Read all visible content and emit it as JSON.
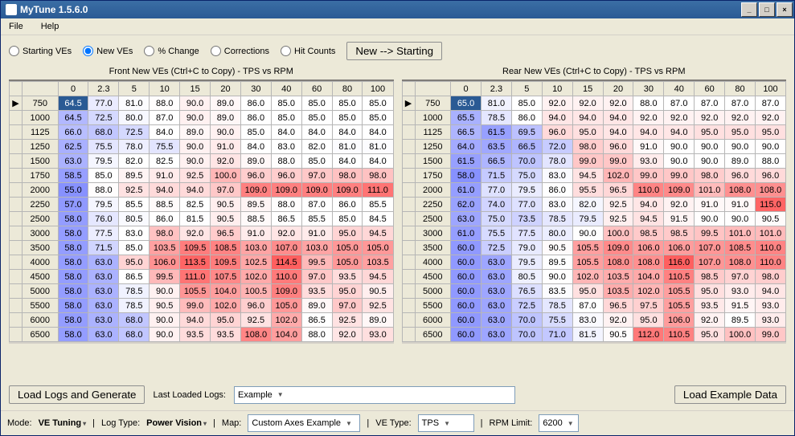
{
  "window": {
    "title": "MyTune 1.5.6.0",
    "min": "_",
    "max": "□",
    "close": "×"
  },
  "menu": {
    "file": "File",
    "help": "Help"
  },
  "radios": {
    "starting": "Starting VEs",
    "new": "New VEs",
    "pct": "% Change",
    "corr": "Corrections",
    "hits": "Hit Counts",
    "selected": "new"
  },
  "newStartBtn": "New --> Starting",
  "frontTitle": "Front New VEs (Ctrl+C to Copy) - TPS vs RPM",
  "rearTitle": "Rear New VEs (Ctrl+C to Copy) - TPS vs RPM",
  "cols": [
    "0",
    "2.3",
    "5",
    "10",
    "15",
    "20",
    "30",
    "40",
    "60",
    "80",
    "100"
  ],
  "rows": [
    "750",
    "1000",
    "1125",
    "1250",
    "1500",
    "1750",
    "2000",
    "2250",
    "2500",
    "3000",
    "3500",
    "4000",
    "4500",
    "5000",
    "5500",
    "6000",
    "6500"
  ],
  "chart_data": [
    {
      "type": "table",
      "title": "Front New VEs - TPS vs RPM",
      "xlabel": "TPS",
      "ylabel": "RPM",
      "x": [
        "0",
        "2.3",
        "5",
        "10",
        "15",
        "20",
        "30",
        "40",
        "60",
        "80",
        "100"
      ],
      "y": [
        "750",
        "1000",
        "1125",
        "1250",
        "1500",
        "1750",
        "2000",
        "2250",
        "2500",
        "3000",
        "3500",
        "4000",
        "4500",
        "5000",
        "5500",
        "6000",
        "6500"
      ],
      "values": [
        [
          64.5,
          77.0,
          81.0,
          88.0,
          90.0,
          89.0,
          86.0,
          85.0,
          85.0,
          85.0,
          85.0
        ],
        [
          64.5,
          72.5,
          80.0,
          87.0,
          90.0,
          89.0,
          86.0,
          85.0,
          85.0,
          85.0,
          85.0
        ],
        [
          66.0,
          68.0,
          72.5,
          84.0,
          89.0,
          90.0,
          85.0,
          84.0,
          84.0,
          84.0,
          84.0
        ],
        [
          62.5,
          75.5,
          78.0,
          75.5,
          90.0,
          91.0,
          84.0,
          83.0,
          82.0,
          81.0,
          81.0
        ],
        [
          63.0,
          79.5,
          82.0,
          82.5,
          90.0,
          92.0,
          89.0,
          88.0,
          85.0,
          84.0,
          84.0
        ],
        [
          58.5,
          85.0,
          89.5,
          91.0,
          92.5,
          100.0,
          96.0,
          96.0,
          97.0,
          98.0,
          98.0
        ],
        [
          55.0,
          88.0,
          92.5,
          94.0,
          94.0,
          97.0,
          109.0,
          109.0,
          109.0,
          109.0,
          111.0
        ],
        [
          57.0,
          79.5,
          85.5,
          88.5,
          82.5,
          90.5,
          89.5,
          88.0,
          87.0,
          86.0,
          85.5
        ],
        [
          58.0,
          76.0,
          80.5,
          86.0,
          81.5,
          90.5,
          88.5,
          86.5,
          85.5,
          85.0,
          84.5
        ],
        [
          58.0,
          77.5,
          83.0,
          98.0,
          92.0,
          96.5,
          91.0,
          92.0,
          91.0,
          95.0,
          94.5
        ],
        [
          58.0,
          71.5,
          85.0,
          103.5,
          109.5,
          108.5,
          103.0,
          107.0,
          103.0,
          105.0,
          105.0
        ],
        [
          58.0,
          63.0,
          95.0,
          106.0,
          113.5,
          109.5,
          102.5,
          114.5,
          99.5,
          105.0,
          103.5
        ],
        [
          58.0,
          63.0,
          86.5,
          99.5,
          111.0,
          107.5,
          102.0,
          110.0,
          97.0,
          93.5,
          94.5
        ],
        [
          58.0,
          63.0,
          78.5,
          90.0,
          105.5,
          104.0,
          100.5,
          109.0,
          93.5,
          95.0,
          90.5
        ],
        [
          58.0,
          63.0,
          78.5,
          90.5,
          99.0,
          102.0,
          96.0,
          105.0,
          89.0,
          97.0,
          92.5
        ],
        [
          58.0,
          63.0,
          68.0,
          90.0,
          94.0,
          95.0,
          92.5,
          102.0,
          86.5,
          92.5,
          89.0
        ],
        [
          58.0,
          63.0,
          68.0,
          90.0,
          93.5,
          93.5,
          108.0,
          104.0,
          88.0,
          92.0,
          93.0
        ]
      ]
    },
    {
      "type": "table",
      "title": "Rear New VEs - TPS vs RPM",
      "xlabel": "TPS",
      "ylabel": "RPM",
      "x": [
        "0",
        "2.3",
        "5",
        "10",
        "15",
        "20",
        "30",
        "40",
        "60",
        "80",
        "100"
      ],
      "y": [
        "750",
        "1000",
        "1125",
        "1250",
        "1500",
        "1750",
        "2000",
        "2250",
        "2500",
        "3000",
        "3500",
        "4000",
        "4500",
        "5000",
        "5500",
        "6000",
        "6500"
      ],
      "values": [
        [
          65.0,
          81.0,
          85.0,
          92.0,
          92.0,
          92.0,
          88.0,
          87.0,
          87.0,
          87.0,
          87.0
        ],
        [
          65.5,
          78.5,
          86.0,
          94.0,
          94.0,
          94.0,
          92.0,
          92.0,
          92.0,
          92.0,
          92.0
        ],
        [
          66.5,
          61.5,
          69.5,
          96.0,
          95.0,
          94.0,
          94.0,
          94.0,
          95.0,
          95.0,
          95.0
        ],
        [
          64.0,
          63.5,
          66.5,
          72.0,
          98.0,
          96.0,
          91.0,
          90.0,
          90.0,
          90.0,
          90.0
        ],
        [
          61.5,
          66.5,
          70.0,
          78.0,
          99.0,
          99.0,
          93.0,
          90.0,
          90.0,
          89.0,
          88.0
        ],
        [
          58.0,
          71.5,
          75.0,
          83.0,
          94.5,
          102.0,
          99.0,
          99.0,
          98.0,
          96.0,
          96.0
        ],
        [
          61.0,
          77.0,
          79.5,
          86.0,
          95.5,
          96.5,
          110.0,
          109.0,
          101.0,
          108.0,
          108.0
        ],
        [
          62.0,
          74.0,
          77.0,
          83.0,
          82.0,
          92.5,
          94.0,
          92.0,
          91.0,
          91.0,
          115.0
        ],
        [
          63.0,
          75.0,
          73.5,
          78.5,
          79.5,
          92.5,
          94.5,
          91.5,
          90.0,
          90.0,
          90.5
        ],
        [
          61.0,
          75.5,
          77.5,
          80.0,
          90.0,
          100.0,
          98.5,
          98.5,
          99.5,
          101.0,
          101.0
        ],
        [
          60.0,
          72.5,
          79.0,
          90.5,
          105.5,
          109.0,
          106.0,
          106.0,
          107.0,
          108.5,
          110.0
        ],
        [
          60.0,
          63.0,
          79.5,
          89.5,
          105.5,
          108.0,
          108.0,
          116.0,
          107.0,
          108.0,
          110.0
        ],
        [
          60.0,
          63.0,
          80.5,
          90.0,
          102.0,
          103.5,
          104.0,
          110.5,
          98.5,
          97.0,
          98.0
        ],
        [
          60.0,
          63.0,
          76.5,
          83.5,
          95.0,
          103.5,
          102.0,
          105.5,
          95.0,
          93.0,
          94.0
        ],
        [
          60.0,
          63.0,
          72.5,
          78.5,
          87.0,
          96.5,
          97.5,
          105.5,
          93.5,
          91.5,
          93.0
        ],
        [
          60.0,
          63.0,
          70.0,
          75.5,
          83.0,
          92.0,
          95.0,
          106.0,
          92.0,
          89.5,
          93.0
        ],
        [
          60.0,
          63.0,
          70.0,
          71.0,
          81.5,
          90.5,
          112.0,
          110.5,
          95.0,
          100.0,
          99.0
        ]
      ]
    }
  ],
  "bottom": {
    "loadLogs": "Load Logs and Generate",
    "lastLoaded": "Last Loaded Logs:",
    "lastLoadedVal": "Example",
    "loadExample": "Load Example Data"
  },
  "status": {
    "modeLbl": "Mode:",
    "mode": "VE Tuning",
    "logLbl": "Log Type:",
    "log": "Power Vision",
    "mapLbl": "Map:",
    "map": "Custom Axes Example",
    "veLbl": "VE Type:",
    "ve": "TPS",
    "rpmLbl": "RPM Limit:",
    "rpm": "6200"
  }
}
